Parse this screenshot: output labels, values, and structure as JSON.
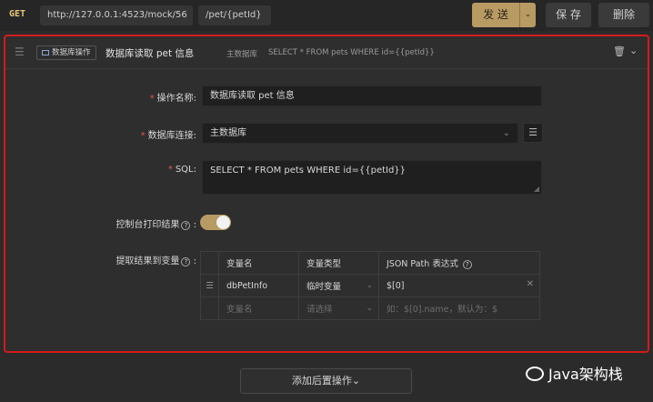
{
  "topbar": {
    "method": "GET",
    "url_host": "http://127.0.0.1:4523/mock/56",
    "url_path": "/pet/{petId}",
    "send_label": "发 送",
    "send_dropdown": "⌄",
    "save_label": "保 存",
    "delete_label": "删除"
  },
  "step": {
    "drag_glyph": "☰",
    "tag_label": "数据库操作",
    "title": "数据库读取 pet 信息",
    "db_name": "主数据库",
    "sql_preview": "SELECT * FROM pets WHERE id={{petId}}"
  },
  "form": {
    "op_name_label": "操作名称:",
    "op_name_value": "数据库读取 pet 信息",
    "db_conn_label": "数据库连接:",
    "db_conn_value": "主数据库",
    "sql_label": "SQL:",
    "sql_value": "SELECT * FROM pets WHERE id={{petId}}",
    "print_label": "控制台打印结果",
    "print_enabled": true,
    "extract_label": "提取结果到变量",
    "required_mark": "*",
    "colon": ":",
    "help_glyph": "?"
  },
  "table": {
    "headers": [
      "变量名",
      "变量类型",
      "JSON Path 表达式"
    ],
    "rows": [
      {
        "name": "dbPetInfo",
        "type": "临时变量",
        "path": "$[0]"
      }
    ],
    "placeholders": {
      "name": "变量名",
      "type": "请选择",
      "path": "如：$[0].name，默认为：$"
    }
  },
  "footer": {
    "add_label": "添加后置操作",
    "watermark": "Java架构栈"
  },
  "colors": {
    "accent": "#b89a63",
    "highlight_border": "#d41a1a"
  }
}
